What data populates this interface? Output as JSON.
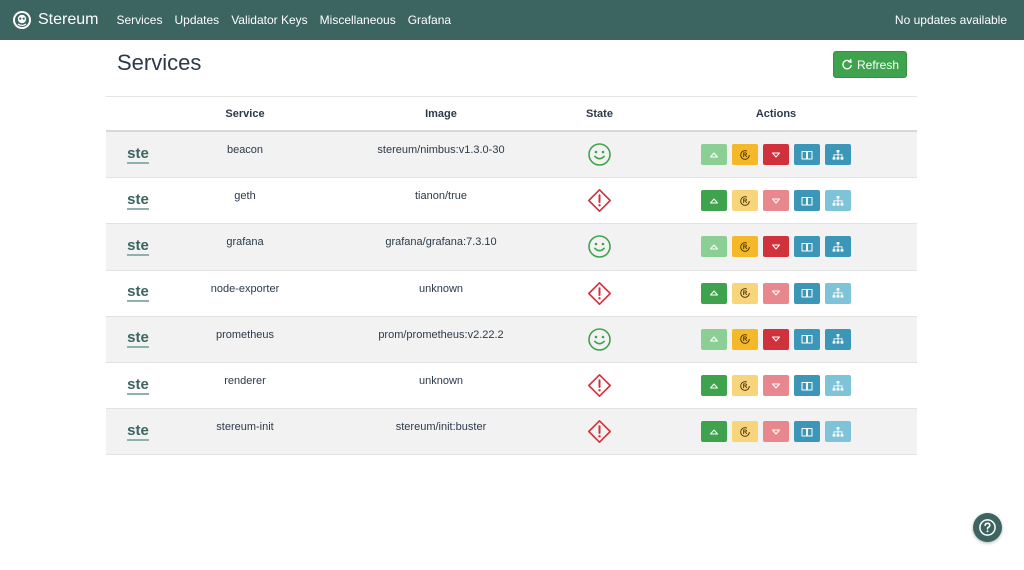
{
  "navbar": {
    "brand": "Stereum",
    "links": [
      "Services",
      "Updates",
      "Validator Keys",
      "Miscellaneous",
      "Grafana"
    ],
    "status": "No updates available"
  },
  "page": {
    "title": "Services",
    "refresh_label": "Refresh"
  },
  "table": {
    "headers": {
      "service": "Service",
      "image": "Image",
      "state": "State",
      "actions": "Actions"
    },
    "rows": [
      {
        "logo": "ste",
        "service": "beacon",
        "image": "stereum/nimbus:v1.3.0-30",
        "state": "running"
      },
      {
        "logo": "ste",
        "service": "geth",
        "image": "tianon/true",
        "state": "stopped"
      },
      {
        "logo": "ste",
        "service": "grafana",
        "image": "grafana/grafana:7.3.10",
        "state": "running"
      },
      {
        "logo": "ste",
        "service": "node-exporter",
        "image": "unknown",
        "state": "stopped"
      },
      {
        "logo": "ste",
        "service": "prometheus",
        "image": "prom/prometheus:v2.22.2",
        "state": "running"
      },
      {
        "logo": "ste",
        "service": "renderer",
        "image": "unknown",
        "state": "stopped"
      },
      {
        "logo": "ste",
        "service": "stereum-init",
        "image": "stereum/init:buster",
        "state": "stopped"
      }
    ]
  },
  "icons": {
    "brand": "stereum-logo-icon",
    "refresh": "refresh-icon",
    "running": "smiley-face-icon",
    "stopped": "warning-diamond-icon",
    "start": "triangle-up-icon",
    "restart": "restart-icon",
    "stop": "triangle-down-icon",
    "logs": "book-icon",
    "network": "network-icon",
    "help": "question-circle-icon"
  },
  "colors": {
    "navbar": "#3c6461",
    "success": "#3fa34d",
    "warning": "#f5b828",
    "danger": "#d0323c",
    "info": "#3b96b8"
  }
}
